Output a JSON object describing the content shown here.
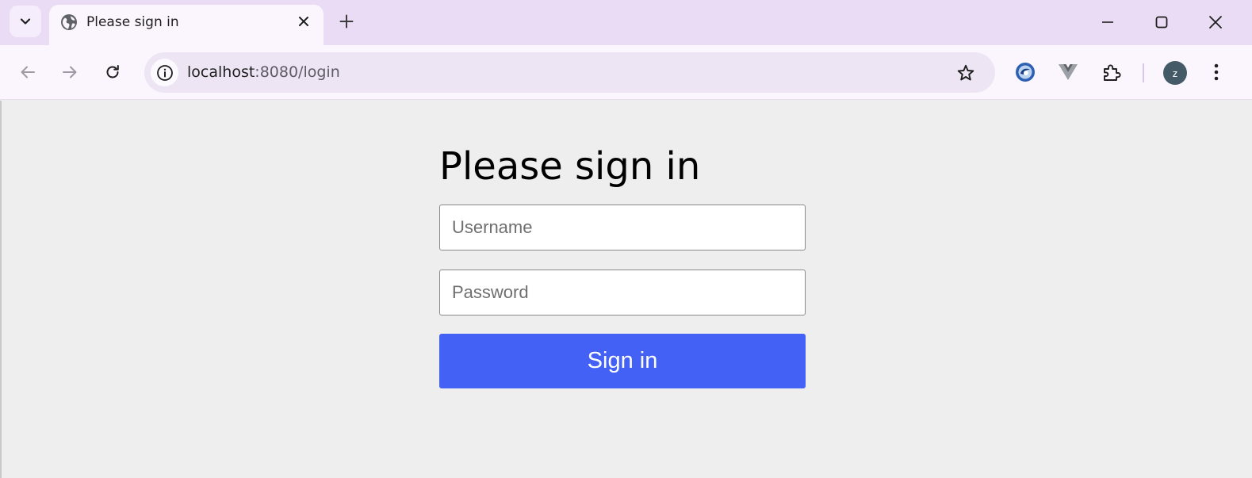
{
  "browser": {
    "tab": {
      "title": "Please sign in"
    },
    "address_bar": {
      "host": "localhost",
      "rest": ":8080/login"
    },
    "profile": {
      "initial": "z"
    },
    "icons": [
      "tab-search-icon",
      "globe-icon",
      "close-icon",
      "plus-icon",
      "minimize-icon",
      "maximize-icon",
      "window-close-icon",
      "back-arrow-icon",
      "forward-arrow-icon",
      "reload-icon",
      "info-icon",
      "star-icon",
      "extension-logo-icon",
      "vue-devtools-icon",
      "puzzle-icon",
      "kebab-menu-icon"
    ]
  },
  "login": {
    "heading": "Please sign in",
    "username": {
      "placeholder": "Username",
      "value": ""
    },
    "password": {
      "placeholder": "Password",
      "value": ""
    },
    "submit_label": "Sign in"
  },
  "colors": {
    "tabstrip": "#e9dcf4",
    "toolbar": "#fbf6fe",
    "page_background": "#eeeeee",
    "primary_button": "#4361f5"
  }
}
